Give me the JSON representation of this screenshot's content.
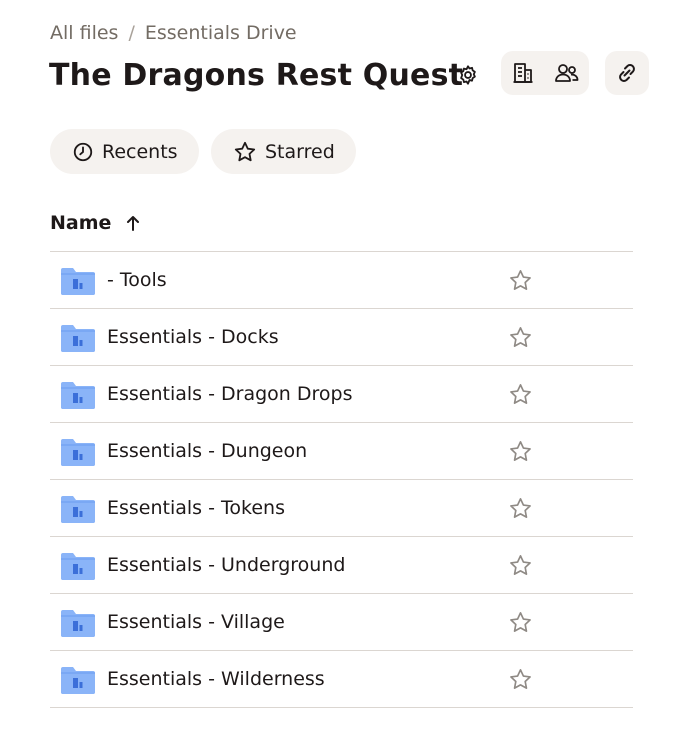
{
  "breadcrumb": {
    "items": [
      {
        "label": "All files"
      },
      {
        "label": "Essentials Drive"
      }
    ],
    "separator": "/"
  },
  "header": {
    "title": "The Dragons Rest Quest",
    "icons": [
      "gear-icon",
      "building-icon",
      "people-icon",
      "link-icon"
    ]
  },
  "filters": [
    {
      "label": "Recents",
      "icon": "clock-icon"
    },
    {
      "label": "Starred",
      "icon": "star-icon"
    }
  ],
  "table": {
    "column_name": "Name",
    "sort": "ascending",
    "rows": [
      {
        "name": "- Tools",
        "starred": false
      },
      {
        "name": "Essentials - Docks",
        "starred": false
      },
      {
        "name": "Essentials - Dragon Drops",
        "starred": false
      },
      {
        "name": "Essentials - Dungeon",
        "starred": false
      },
      {
        "name": "Essentials - Tokens",
        "starred": false
      },
      {
        "name": "Essentials - Underground",
        "starred": false
      },
      {
        "name": "Essentials - Village",
        "starred": false
      },
      {
        "name": "Essentials - Wilderness",
        "starred": false
      }
    ]
  },
  "colors": {
    "folder": "#8ab4f8",
    "folder_tab": "#6b9cf0",
    "folder_mark": "#3b6fd9",
    "chip_bg": "#f5f2ef",
    "divider": "#dbd6d1",
    "text": "#1e1919",
    "muted": "#736c64"
  }
}
